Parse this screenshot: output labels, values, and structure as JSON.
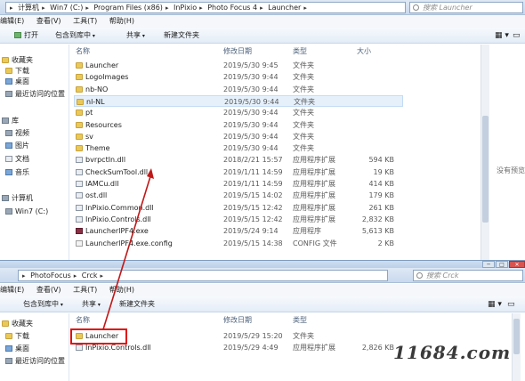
{
  "top_window": {
    "breadcrumb": [
      "计算机",
      "Win7 (C:)",
      "Program Files (x86)",
      "InPixio",
      "Photo Focus 4",
      "Launcher"
    ],
    "search_placeholder": "搜索 Launcher",
    "menu": [
      "编辑(E)",
      "查看(V)",
      "工具(T)",
      "帮助(H)"
    ],
    "toolbar": {
      "open": "打开",
      "include": "包含到库中",
      "share": "共享",
      "new_folder": "新建文件夹"
    },
    "columns": {
      "name": "名称",
      "date": "修改日期",
      "type": "类型",
      "size": "大小"
    },
    "nav": [
      {
        "label": "收藏夹",
        "icon": "star-icon"
      },
      {
        "label": "下载",
        "icon": "download-folder-icon"
      },
      {
        "label": "桌面",
        "icon": "desktop-icon"
      },
      {
        "label": "最近访问的位置",
        "icon": "recent-places-icon"
      },
      {
        "label": "库",
        "icon": "library-icon"
      },
      {
        "label": "视频",
        "icon": "video-library-icon"
      },
      {
        "label": "图片",
        "icon": "pictures-library-icon"
      },
      {
        "label": "文档",
        "icon": "documents-library-icon"
      },
      {
        "label": "音乐",
        "icon": "music-library-icon"
      },
      {
        "label": "计算机",
        "icon": "computer-icon"
      },
      {
        "label": "Win7 (C:)",
        "icon": "drive-icon"
      }
    ],
    "files": [
      {
        "name": "Launcher",
        "date": "2019/5/30 9:45",
        "type": "文件夹",
        "size": "",
        "icon": "folder"
      },
      {
        "name": "LogoImages",
        "date": "2019/5/30 9:44",
        "type": "文件夹",
        "size": "",
        "icon": "folder"
      },
      {
        "name": "nb-NO",
        "date": "2019/5/30 9:44",
        "type": "文件夹",
        "size": "",
        "icon": "folder"
      },
      {
        "name": "nl-NL",
        "date": "2019/5/30 9:44",
        "type": "文件夹",
        "size": "",
        "icon": "folder"
      },
      {
        "name": "pt",
        "date": "2019/5/30 9:44",
        "type": "文件夹",
        "size": "",
        "icon": "folder"
      },
      {
        "name": "Resources",
        "date": "2019/5/30 9:44",
        "type": "文件夹",
        "size": "",
        "icon": "folder"
      },
      {
        "name": "sv",
        "date": "2019/5/30 9:44",
        "type": "文件夹",
        "size": "",
        "icon": "folder"
      },
      {
        "name": "Theme",
        "date": "2019/5/30 9:44",
        "type": "文件夹",
        "size": "",
        "icon": "folder"
      },
      {
        "name": "bvrpctln.dll",
        "date": "2018/2/21 15:57",
        "type": "应用程序扩展",
        "size": "594 KB",
        "icon": "dll"
      },
      {
        "name": "CheckSumTool.dll",
        "date": "2019/1/11 14:59",
        "type": "应用程序扩展",
        "size": "19 KB",
        "icon": "dll"
      },
      {
        "name": "IAMCu.dll",
        "date": "2019/1/11 14:59",
        "type": "应用程序扩展",
        "size": "414 KB",
        "icon": "dll"
      },
      {
        "name": "ost.dll",
        "date": "2019/5/15 14:02",
        "type": "应用程序扩展",
        "size": "179 KB",
        "icon": "dll"
      },
      {
        "name": "InPixio.Common.dll",
        "date": "2019/5/15 12:42",
        "type": "应用程序扩展",
        "size": "261 KB",
        "icon": "dll"
      },
      {
        "name": "InPixio.Controls.dll",
        "date": "2019/5/15 12:42",
        "type": "应用程序扩展",
        "size": "2,832 KB",
        "icon": "dll"
      },
      {
        "name": "LauncherIPF4.exe",
        "date": "2019/5/24 9:14",
        "type": "应用程序",
        "size": "5,613 KB",
        "icon": "exe"
      },
      {
        "name": "LauncherIPF4.exe.config",
        "date": "2019/5/15 14:38",
        "type": "CONFIG 文件",
        "size": "2 KB",
        "icon": "cfg"
      }
    ],
    "preview_text": "没有预览"
  },
  "bottom_window": {
    "breadcrumb": [
      "PhotoFocus",
      "Crck"
    ],
    "search_placeholder": "搜索 Crck",
    "menu": [
      "编辑(E)",
      "查看(V)",
      "工具(T)",
      "帮助(H)"
    ],
    "toolbar": {
      "include": "包含到库中",
      "share": "共享",
      "new_folder": "新建文件夹"
    },
    "columns": {
      "name": "名称",
      "date": "修改日期",
      "type": "类型"
    },
    "nav": [
      {
        "label": "收藏夹",
        "icon": "star-icon"
      },
      {
        "label": "下载",
        "icon": "download-folder-icon"
      },
      {
        "label": "桌面",
        "icon": "desktop-icon"
      },
      {
        "label": "最近访问的位置",
        "icon": "recent-places-icon"
      }
    ],
    "files": [
      {
        "name": "Launcher",
        "date": "2019/5/29 15:20",
        "type": "文件夹",
        "size": "",
        "icon": "folder"
      },
      {
        "name": "InPixio.Controls.dll",
        "date": "2019/5/29 4:49",
        "type": "应用程序扩展",
        "size": "2,826 KB",
        "icon": "dll"
      }
    ]
  },
  "watermark": "11684.com",
  "colors": {
    "highlight": "#e01010",
    "arrow": "#c01818"
  }
}
